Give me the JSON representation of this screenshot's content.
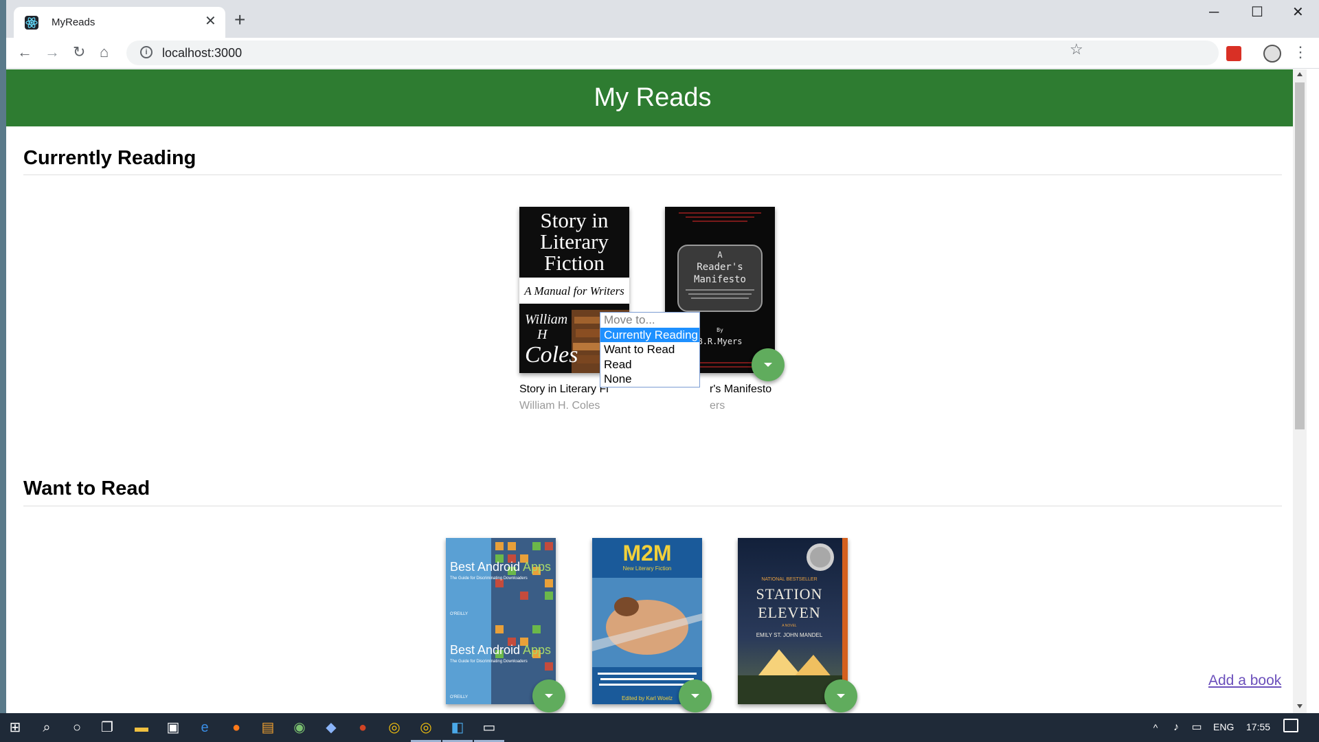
{
  "browser": {
    "tab_title": "MyReads",
    "new_tab": "+",
    "url": "localhost:3000",
    "info_glyph": "i"
  },
  "app": {
    "title": "My Reads",
    "add_link": "Add a book"
  },
  "shelves": [
    {
      "title": "Currently Reading",
      "books": [
        {
          "title": "Story in Literary Fi",
          "author": "William H. Coles",
          "cover": "story-literary-fiction"
        },
        {
          "title": "r's Manifesto",
          "author": "ers",
          "cover": "readers-manifesto"
        }
      ]
    },
    {
      "title": "Want to Read",
      "books": [
        {
          "cover": "best-android-apps"
        },
        {
          "cover": "m2m"
        },
        {
          "cover": "station-eleven"
        }
      ]
    }
  ],
  "covers": {
    "story": {
      "line1": "Story in",
      "line2": "Literary",
      "line3": "Fiction",
      "subtitle": "A Manual for Writers",
      "author1": "William",
      "author2": "H",
      "author3": "Coles"
    },
    "manifesto": {
      "line1": "A",
      "line2": "Reader's",
      "line3": "Manifesto",
      "by": "By",
      "author": "B.R.Myers"
    },
    "android": {
      "title1": "Best",
      "title2": "Android",
      "title3": "Apps",
      "sub": "The Guide for Discriminating Downloaders",
      "pub": "O'REILLY"
    },
    "m2m": {
      "title": "M2M",
      "sub": "New Literary Fiction",
      "editor": "Edited by Karl Woelz"
    },
    "station": {
      "badge": "NATIONAL BESTSELLER",
      "line1": "STATION",
      "line2": "ELEVEN",
      "novel": "A NOVEL",
      "author": "EMILY ST. JOHN MANDEL"
    }
  },
  "dropdown": {
    "options": [
      {
        "label": "Move to...",
        "state": "disabled"
      },
      {
        "label": "Currently Reading",
        "state": "selected"
      },
      {
        "label": "Want to Read",
        "state": "normal"
      },
      {
        "label": "Read",
        "state": "normal"
      },
      {
        "label": "None",
        "state": "normal"
      }
    ]
  },
  "taskbar": {
    "language": "ENG",
    "time": "17:55"
  },
  "colors": {
    "header_green": "#2e7c31",
    "changer_green": "#60ac5d",
    "select_blue": "#1e90ff"
  }
}
